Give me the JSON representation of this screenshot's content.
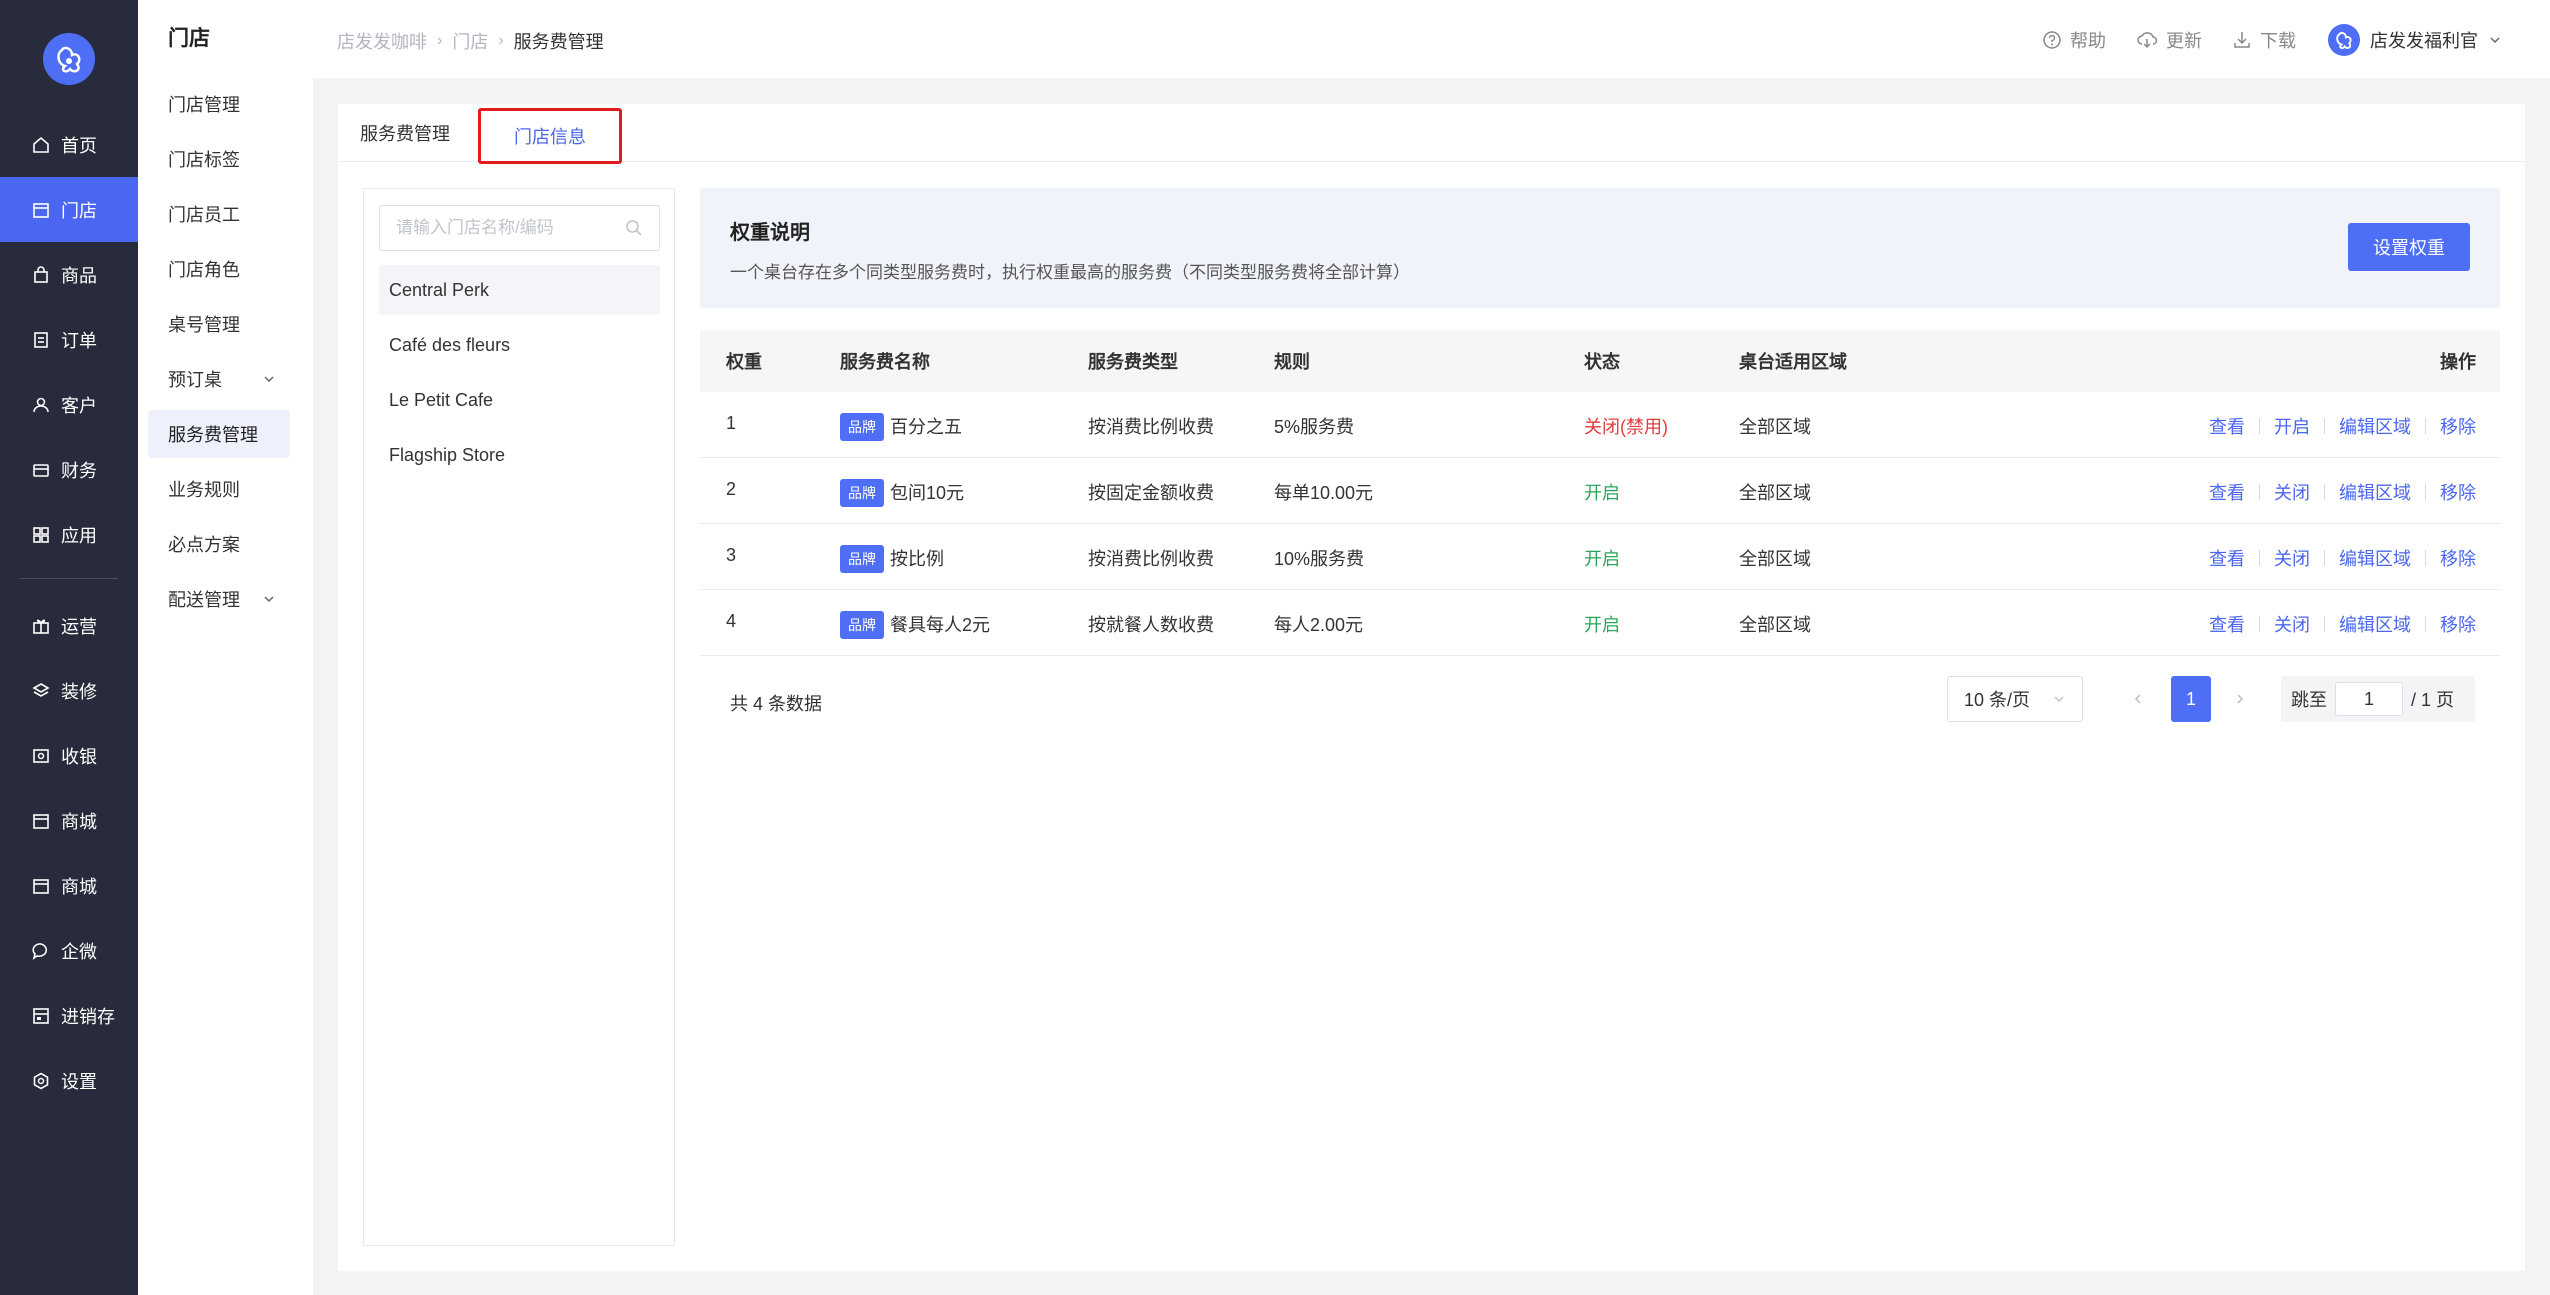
{
  "rail": {
    "items": [
      {
        "label": "首页",
        "icon": "home-icon"
      },
      {
        "label": "门店",
        "icon": "store-icon",
        "active": true
      },
      {
        "label": "商品",
        "icon": "bag-icon"
      },
      {
        "label": "订单",
        "icon": "order-icon"
      },
      {
        "label": "客户",
        "icon": "user-icon"
      },
      {
        "label": "财务",
        "icon": "wallet-icon"
      },
      {
        "label": "应用",
        "icon": "apps-icon"
      },
      {
        "label": "运营",
        "icon": "gift-icon"
      },
      {
        "label": "装修",
        "icon": "layers-icon"
      },
      {
        "label": "收银",
        "icon": "cashier-icon"
      },
      {
        "label": "商城",
        "icon": "shop-icon"
      },
      {
        "label": "商城",
        "icon": "shop-icon"
      },
      {
        "label": "企微",
        "icon": "chat-icon"
      },
      {
        "label": "进销存",
        "icon": "inventory-icon"
      },
      {
        "label": "设置",
        "icon": "settings-icon"
      }
    ]
  },
  "submenu": {
    "title": "门店",
    "items": [
      {
        "label": "门店管理"
      },
      {
        "label": "门店标签"
      },
      {
        "label": "门店员工"
      },
      {
        "label": "门店角色"
      },
      {
        "label": "桌号管理"
      },
      {
        "label": "预订桌",
        "expandable": true
      },
      {
        "label": "服务费管理",
        "active": true
      },
      {
        "label": "业务规则"
      },
      {
        "label": "必点方案"
      },
      {
        "label": "配送管理",
        "expandable": true
      }
    ]
  },
  "header": {
    "breadcrumb": [
      "店发发咖啡",
      "门店",
      "服务费管理"
    ],
    "help": "帮助",
    "update": "更新",
    "download": "下载",
    "user": "店发发福利官"
  },
  "tabs": [
    "服务费管理",
    "门店信息"
  ],
  "storeList": {
    "searchPlaceholder": "请输入门店名称/编码",
    "stores": [
      "Central Perk",
      "Café des fleurs",
      "Le Petit Cafe",
      "Flagship Store"
    ]
  },
  "weight": {
    "title": "权重说明",
    "desc": "一个桌台存在多个同类型服务费时，执行权重最高的服务费（不同类型服务费将全部计算）",
    "button": "设置权重"
  },
  "table": {
    "columns": [
      "权重",
      "服务费名称",
      "服务费类型",
      "规则",
      "状态",
      "桌台适用区域",
      "操作"
    ],
    "rows": [
      {
        "weight": "1",
        "tag": "品牌",
        "name": "百分之五",
        "type": "按消费比例收费",
        "rule": "5%服务费",
        "status": "关闭(禁用)",
        "status_kind": "off",
        "area": "全部区域",
        "ops": [
          "查看",
          "开启",
          "编辑区域",
          "移除"
        ]
      },
      {
        "weight": "2",
        "tag": "品牌",
        "name": "包间10元",
        "type": "按固定金额收费",
        "rule": "每单10.00元",
        "status": "开启",
        "status_kind": "on",
        "area": "全部区域",
        "ops": [
          "查看",
          "关闭",
          "编辑区域",
          "移除"
        ]
      },
      {
        "weight": "3",
        "tag": "品牌",
        "name": "按比例",
        "type": "按消费比例收费",
        "rule": "10%服务费",
        "status": "开启",
        "status_kind": "on",
        "area": "全部区域",
        "ops": [
          "查看",
          "关闭",
          "编辑区域",
          "移除"
        ]
      },
      {
        "weight": "4",
        "tag": "品牌",
        "name": "餐具每人2元",
        "type": "按就餐人数收费",
        "rule": "每人2.00元",
        "status": "开启",
        "status_kind": "on",
        "area": "全部区域",
        "ops": [
          "查看",
          "关闭",
          "编辑区域",
          "移除"
        ]
      }
    ]
  },
  "pagination": {
    "total": "共 4 条数据",
    "pageSize": "10 条/页",
    "current": "1",
    "jumpLabel": "跳至",
    "jumpValue": "1",
    "pagesLabel": "/ 1 页"
  },
  "colors": {
    "primary": "#4d6ef5",
    "rail": "#272b3b",
    "danger": "#e03a3a",
    "success": "#2aa55a",
    "highlight_box": "#e01c1c"
  }
}
